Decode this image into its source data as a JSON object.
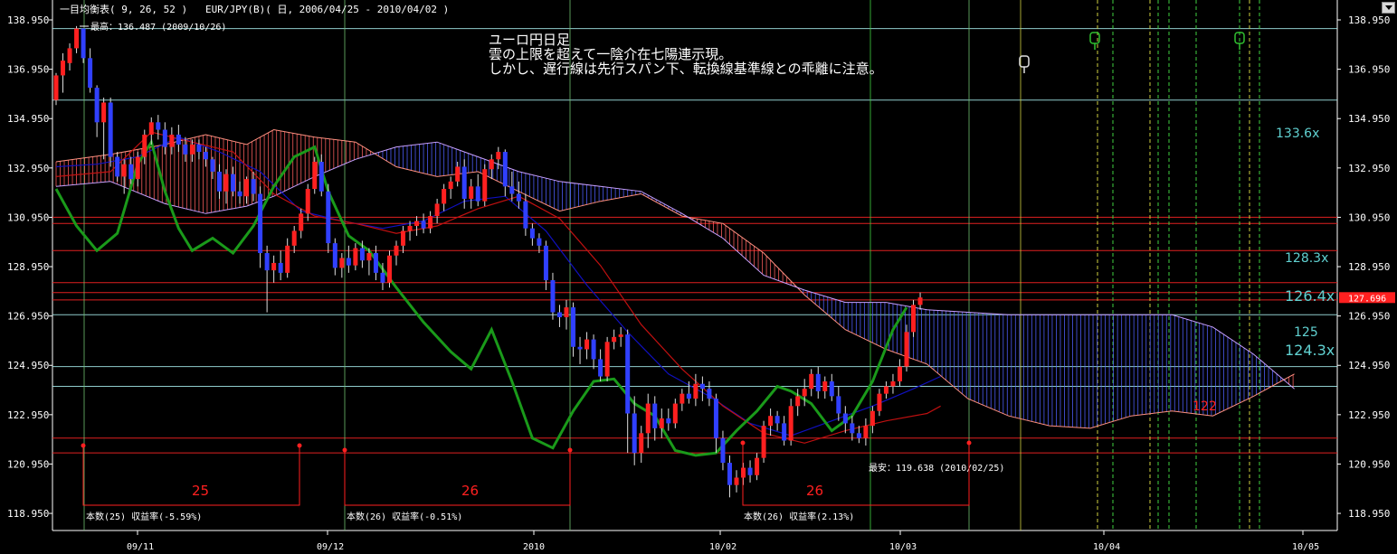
{
  "header": {
    "indicator": "一目均衡表( 9, 26, 52 )",
    "symbol": "EUR/JPY(B)( 日, 2006/04/25 - 2010/04/02 )"
  },
  "annotation": {
    "lines": [
      "ユーロ円日足",
      "雲の上限を超えて一陰介在七陽連示現。",
      "しかし、遅行線は先行スパン下、転換線基準線との乖離に注意。"
    ]
  },
  "labels": {
    "high": "最高：136.487 (2009/10/26)",
    "low": "最安：119.638 (2010/02/25)",
    "last_price": "127.696",
    "count_labels": [
      "25",
      "26",
      "26"
    ],
    "yield_labels": [
      "本数(25) 収益率(-5.59%)",
      "本数(26) 収益率(-0.51%)",
      "本数(26) 収益率(2.13%)"
    ],
    "target_labels": [
      "133.6x",
      "128.3x",
      "126.4x",
      "125",
      "124.3x",
      "122"
    ]
  },
  "colors": {
    "background": "#000000",
    "bull": "#ff2020",
    "bear": "#3040ff",
    "chikou": "#1a9a1a",
    "kijun": "#c01010",
    "tenkan": "#1010c0",
    "senkou_a": "#ff9080",
    "senkou_b": "#c8a0ff",
    "cloud_bear": "#5060ff",
    "cloud_bull": "#ff6060",
    "hline_red": "#e02020",
    "hline_cyan": "#a8f0f0",
    "vline_green": "#40d040",
    "vline_yellow": "#d0d040",
    "axis_text": "#ffffff",
    "target_text": "#60d0d0"
  },
  "chart_data": {
    "type": "candlestick",
    "indicator": "Ichimoku",
    "ylim": [
      118.0,
      139.5
    ],
    "y_ticks": [
      138.95,
      136.95,
      134.95,
      132.95,
      130.95,
      128.95,
      126.95,
      124.95,
      122.95,
      120.95,
      118.95
    ],
    "y_tick_labels": [
      "138.950",
      "136.950",
      "134.950",
      "132.950",
      "130.950",
      "128.950",
      "126.950",
      "124.950",
      "122.950",
      "120.950",
      "118.950"
    ],
    "x_tick_labels": [
      "09/11",
      "09/12",
      "2010",
      "10/02",
      "10/03",
      "10/04",
      "10/05"
    ],
    "horizontal_levels_red": [
      130.95,
      130.7,
      129.6,
      128.3,
      127.9,
      127.6,
      122.0,
      121.4
    ],
    "horizontal_levels_cyan": [
      138.6,
      135.7,
      127.0,
      124.9,
      124.1
    ],
    "candles": [
      [
        135.7,
        136.8,
        135.5,
        136.7
      ],
      [
        136.7,
        137.6,
        136.0,
        137.3
      ],
      [
        137.2,
        138.0,
        136.9,
        137.8
      ],
      [
        137.8,
        138.7,
        137.6,
        138.6
      ],
      [
        138.6,
        138.6,
        137.2,
        137.4
      ],
      [
        137.4,
        137.8,
        136.0,
        136.2
      ],
      [
        136.2,
        136.3,
        134.2,
        134.8
      ],
      [
        134.8,
        135.8,
        133.3,
        135.6
      ],
      [
        135.6,
        135.8,
        133.0,
        133.4
      ],
      [
        133.4,
        133.6,
        132.4,
        132.6
      ],
      [
        132.6,
        133.3,
        131.9,
        133.1
      ],
      [
        133.1,
        133.4,
        132.3,
        132.5
      ],
      [
        132.5,
        133.6,
        132.2,
        133.4
      ],
      [
        133.4,
        134.5,
        133.1,
        134.3
      ],
      [
        134.3,
        135.0,
        133.9,
        134.8
      ],
      [
        134.8,
        135.1,
        134.1,
        134.5
      ],
      [
        134.5,
        134.8,
        133.5,
        133.8
      ],
      [
        133.8,
        134.6,
        133.5,
        134.3
      ],
      [
        134.3,
        134.7,
        133.6,
        133.9
      ],
      [
        133.9,
        134.2,
        133.2,
        133.5
      ],
      [
        133.5,
        134.1,
        133.2,
        133.9
      ],
      [
        133.9,
        134.1,
        133.3,
        133.6
      ],
      [
        133.6,
        133.8,
        133.0,
        133.3
      ],
      [
        133.3,
        133.4,
        132.5,
        132.8
      ],
      [
        132.8,
        133.1,
        131.7,
        132.0
      ],
      [
        132.0,
        132.9,
        131.5,
        132.7
      ],
      [
        132.7,
        133.0,
        131.8,
        132.0
      ],
      [
        132.0,
        132.4,
        131.5,
        131.8
      ],
      [
        131.8,
        132.6,
        131.5,
        132.5
      ],
      [
        132.5,
        132.8,
        131.6,
        131.9
      ],
      [
        131.9,
        132.2,
        128.9,
        129.5
      ],
      [
        129.5,
        129.8,
        127.1,
        128.8
      ],
      [
        128.8,
        129.4,
        128.3,
        129.1
      ],
      [
        129.1,
        129.6,
        128.4,
        128.7
      ],
      [
        128.7,
        130.1,
        128.5,
        129.8
      ],
      [
        129.8,
        130.6,
        129.5,
        130.4
      ],
      [
        130.4,
        131.3,
        130.1,
        131.1
      ],
      [
        131.1,
        132.3,
        130.8,
        132.1
      ],
      [
        132.1,
        133.4,
        131.9,
        133.2
      ],
      [
        133.2,
        133.5,
        131.8,
        132.0
      ],
      [
        132.0,
        132.3,
        129.5,
        129.9
      ],
      [
        129.9,
        130.1,
        128.6,
        128.9
      ],
      [
        128.9,
        129.5,
        128.5,
        129.3
      ],
      [
        129.3,
        129.8,
        128.7,
        129.0
      ],
      [
        129.0,
        129.9,
        128.8,
        129.7
      ],
      [
        129.7,
        130.0,
        128.9,
        129.2
      ],
      [
        129.2,
        129.7,
        128.6,
        129.5
      ],
      [
        129.5,
        129.8,
        128.4,
        128.7
      ],
      [
        128.7,
        129.1,
        128.0,
        128.3
      ],
      [
        128.3,
        129.6,
        128.1,
        129.4
      ],
      [
        129.4,
        130.0,
        129.0,
        129.8
      ],
      [
        129.8,
        130.6,
        129.5,
        130.4
      ],
      [
        130.4,
        130.8,
        130.0,
        130.6
      ],
      [
        130.6,
        131.0,
        130.2,
        130.8
      ],
      [
        130.8,
        131.1,
        130.3,
        130.5
      ],
      [
        130.5,
        131.2,
        130.3,
        131.0
      ],
      [
        131.0,
        131.7,
        130.7,
        131.5
      ],
      [
        131.5,
        132.3,
        131.2,
        132.1
      ],
      [
        132.1,
        132.6,
        131.7,
        132.4
      ],
      [
        132.4,
        133.2,
        132.2,
        133.0
      ],
      [
        133.0,
        133.3,
        131.3,
        131.7
      ],
      [
        131.7,
        132.5,
        131.3,
        132.2
      ],
      [
        132.2,
        132.7,
        131.4,
        131.6
      ],
      [
        131.6,
        133.1,
        131.4,
        132.9
      ],
      [
        132.9,
        133.5,
        132.5,
        133.3
      ],
      [
        133.3,
        133.8,
        132.9,
        133.6
      ],
      [
        133.6,
        133.7,
        131.8,
        132.2
      ],
      [
        132.2,
        132.8,
        131.6,
        131.9
      ],
      [
        131.9,
        132.4,
        131.3,
        131.6
      ],
      [
        131.6,
        131.9,
        130.2,
        130.5
      ],
      [
        130.5,
        130.7,
        129.8,
        130.1
      ],
      [
        130.1,
        130.3,
        129.5,
        129.8
      ],
      [
        129.8,
        130.0,
        128.0,
        128.4
      ],
      [
        128.4,
        128.7,
        126.8,
        127.1
      ],
      [
        127.1,
        127.4,
        126.5,
        126.9
      ],
      [
        126.9,
        127.6,
        126.4,
        127.3
      ],
      [
        127.3,
        127.5,
        125.3,
        125.7
      ],
      [
        125.7,
        126.1,
        125.0,
        125.6
      ],
      [
        125.6,
        126.3,
        125.2,
        126.0
      ],
      [
        126.0,
        126.2,
        124.8,
        125.2
      ],
      [
        125.2,
        125.6,
        124.3,
        124.5
      ],
      [
        124.5,
        126.1,
        124.3,
        125.9
      ],
      [
        125.9,
        126.4,
        125.6,
        126.1
      ],
      [
        126.1,
        126.5,
        125.7,
        126.2
      ],
      [
        126.2,
        126.4,
        121.4,
        123.0
      ],
      [
        123.0,
        123.7,
        120.9,
        121.4
      ],
      [
        121.4,
        122.5,
        121.0,
        122.2
      ],
      [
        122.2,
        123.8,
        121.6,
        123.4
      ],
      [
        123.4,
        123.7,
        121.9,
        122.4
      ],
      [
        122.4,
        123.2,
        122.0,
        122.8
      ],
      [
        122.8,
        123.2,
        122.3,
        122.6
      ],
      [
        122.6,
        123.6,
        122.4,
        123.4
      ],
      [
        123.4,
        124.0,
        123.1,
        123.8
      ],
      [
        123.8,
        124.3,
        123.4,
        123.6
      ],
      [
        123.6,
        124.6,
        123.3,
        124.2
      ],
      [
        124.2,
        124.5,
        123.5,
        124.0
      ],
      [
        124.0,
        124.3,
        123.3,
        123.6
      ],
      [
        123.6,
        123.8,
        121.4,
        122.0
      ],
      [
        122.0,
        122.3,
        120.7,
        121.0
      ],
      [
        121.0,
        121.3,
        119.6,
        120.1
      ],
      [
        120.1,
        120.7,
        119.8,
        120.4
      ],
      [
        120.4,
        121.0,
        120.1,
        120.8
      ],
      [
        120.8,
        121.1,
        120.2,
        120.5
      ],
      [
        120.5,
        121.4,
        120.3,
        121.2
      ],
      [
        121.2,
        122.7,
        121.0,
        122.5
      ],
      [
        122.5,
        123.2,
        122.1,
        122.9
      ],
      [
        122.9,
        123.1,
        122.3,
        122.6
      ],
      [
        122.6,
        122.9,
        121.7,
        121.9
      ],
      [
        121.9,
        123.6,
        121.7,
        123.3
      ],
      [
        123.3,
        124.0,
        122.9,
        123.7
      ],
      [
        123.7,
        124.4,
        123.3,
        124.0
      ],
      [
        124.0,
        124.8,
        123.7,
        124.6
      ],
      [
        124.6,
        124.9,
        123.6,
        123.9
      ],
      [
        123.9,
        124.5,
        123.6,
        124.3
      ],
      [
        124.3,
        124.6,
        123.5,
        123.7
      ],
      [
        123.7,
        124.1,
        122.7,
        123.0
      ],
      [
        123.0,
        123.3,
        122.2,
        122.6
      ],
      [
        122.6,
        122.9,
        121.9,
        122.2
      ],
      [
        122.2,
        122.5,
        121.8,
        122.0
      ],
      [
        122.0,
        122.8,
        121.7,
        122.5
      ],
      [
        122.5,
        123.3,
        122.2,
        123.1
      ],
      [
        123.1,
        124.0,
        122.9,
        123.8
      ],
      [
        123.8,
        124.3,
        123.6,
        124.1
      ],
      [
        124.1,
        124.6,
        123.8,
        124.3
      ],
      [
        124.3,
        125.2,
        124.1,
        124.9
      ],
      [
        124.9,
        126.6,
        124.7,
        126.3
      ],
      [
        126.3,
        127.6,
        126.1,
        127.4
      ],
      [
        127.4,
        127.9,
        127.2,
        127.7
      ]
    ],
    "tenkan": [
      [
        0,
        133.0
      ],
      [
        6,
        133.1
      ],
      [
        12,
        133.4
      ],
      [
        18,
        134.2
      ],
      [
        24,
        133.6
      ],
      [
        30,
        132.8
      ],
      [
        36,
        131.2
      ],
      [
        42,
        130.8
      ],
      [
        48,
        130.5
      ],
      [
        54,
        130.8
      ],
      [
        60,
        131.6
      ],
      [
        66,
        131.8
      ],
      [
        72,
        130.4
      ],
      [
        78,
        128.2
      ],
      [
        84,
        126.3
      ],
      [
        90,
        124.6
      ],
      [
        96,
        123.7
      ],
      [
        102,
        122.6
      ],
      [
        108,
        122.1
      ],
      [
        114,
        122.7
      ],
      [
        120,
        123.3
      ],
      [
        126,
        124.0
      ],
      [
        130,
        124.5
      ]
    ],
    "kijun": [
      [
        0,
        132.6
      ],
      [
        8,
        132.8
      ],
      [
        14,
        134.4
      ],
      [
        20,
        134.0
      ],
      [
        26,
        133.6
      ],
      [
        32,
        131.9
      ],
      [
        38,
        131.0
      ],
      [
        44,
        130.7
      ],
      [
        50,
        130.3
      ],
      [
        56,
        130.6
      ],
      [
        62,
        131.3
      ],
      [
        68,
        131.8
      ],
      [
        74,
        130.9
      ],
      [
        80,
        129.0
      ],
      [
        86,
        126.6
      ],
      [
        92,
        124.8
      ],
      [
        98,
        123.3
      ],
      [
        104,
        122.2
      ],
      [
        110,
        121.8
      ],
      [
        116,
        122.3
      ],
      [
        122,
        122.7
      ],
      [
        128,
        123.0
      ],
      [
        130,
        123.3
      ]
    ],
    "chikou": [
      [
        0,
        132.1
      ],
      [
        3,
        130.6
      ],
      [
        6,
        129.6
      ],
      [
        9,
        130.3
      ],
      [
        12,
        133.1
      ],
      [
        14,
        134.0
      ],
      [
        16,
        132.0
      ],
      [
        18,
        130.5
      ],
      [
        20,
        129.6
      ],
      [
        23,
        130.1
      ],
      [
        26,
        129.5
      ],
      [
        29,
        130.6
      ],
      [
        32,
        132.2
      ],
      [
        35,
        133.4
      ],
      [
        38,
        133.8
      ],
      [
        40,
        132.0
      ],
      [
        43,
        130.2
      ],
      [
        46,
        129.6
      ],
      [
        50,
        128.1
      ],
      [
        54,
        126.7
      ],
      [
        58,
        125.5
      ],
      [
        61,
        124.8
      ],
      [
        64,
        126.4
      ],
      [
        67,
        124.3
      ],
      [
        70,
        122.0
      ],
      [
        73,
        121.6
      ],
      [
        76,
        123.1
      ],
      [
        79,
        124.3
      ],
      [
        82,
        124.4
      ],
      [
        85,
        123.4
      ],
      [
        88,
        122.9
      ],
      [
        91,
        121.5
      ],
      [
        94,
        121.3
      ],
      [
        97,
        121.4
      ],
      [
        100,
        122.3
      ],
      [
        103,
        123.1
      ],
      [
        106,
        124.1
      ],
      [
        108,
        123.9
      ],
      [
        111,
        123.4
      ],
      [
        114,
        122.3
      ],
      [
        117,
        122.9
      ],
      [
        120,
        124.3
      ],
      [
        123,
        126.4
      ],
      [
        125,
        127.3
      ]
    ],
    "senkou_a": [
      [
        0,
        133.2
      ],
      [
        8,
        133.5
      ],
      [
        16,
        133.9
      ],
      [
        22,
        134.3
      ],
      [
        28,
        133.9
      ],
      [
        32,
        134.5
      ],
      [
        38,
        134.2
      ],
      [
        44,
        134.0
      ],
      [
        50,
        133.0
      ],
      [
        56,
        132.6
      ],
      [
        62,
        132.8
      ],
      [
        68,
        132.0
      ],
      [
        74,
        131.2
      ],
      [
        80,
        131.6
      ],
      [
        86,
        131.9
      ],
      [
        92,
        131.0
      ],
      [
        98,
        130.7
      ],
      [
        104,
        129.5
      ],
      [
        110,
        127.8
      ],
      [
        116,
        126.4
      ],
      [
        122,
        125.6
      ],
      [
        128,
        125.0
      ],
      [
        134,
        123.6
      ],
      [
        140,
        122.9
      ],
      [
        146,
        122.5
      ],
      [
        152,
        122.4
      ],
      [
        158,
        122.9
      ],
      [
        164,
        123.1
      ],
      [
        170,
        122.9
      ],
      [
        176,
        123.7
      ],
      [
        182,
        124.6
      ]
    ],
    "senkou_b": [
      [
        0,
        132.2
      ],
      [
        8,
        132.4
      ],
      [
        16,
        131.5
      ],
      [
        22,
        131.1
      ],
      [
        28,
        131.4
      ],
      [
        32,
        131.8
      ],
      [
        38,
        132.6
      ],
      [
        44,
        133.3
      ],
      [
        50,
        133.8
      ],
      [
        56,
        134.0
      ],
      [
        62,
        133.4
      ],
      [
        68,
        132.8
      ],
      [
        74,
        132.4
      ],
      [
        80,
        132.2
      ],
      [
        86,
        132.0
      ],
      [
        92,
        131.1
      ],
      [
        98,
        130.1
      ],
      [
        104,
        128.6
      ],
      [
        110,
        128.0
      ],
      [
        116,
        127.5
      ],
      [
        122,
        127.5
      ],
      [
        128,
        127.2
      ],
      [
        134,
        127.1
      ],
      [
        140,
        127.0
      ],
      [
        146,
        127.0
      ],
      [
        152,
        127.0
      ],
      [
        158,
        127.0
      ],
      [
        164,
        127.0
      ],
      [
        170,
        126.5
      ],
      [
        176,
        125.4
      ],
      [
        182,
        124.0
      ]
    ]
  }
}
